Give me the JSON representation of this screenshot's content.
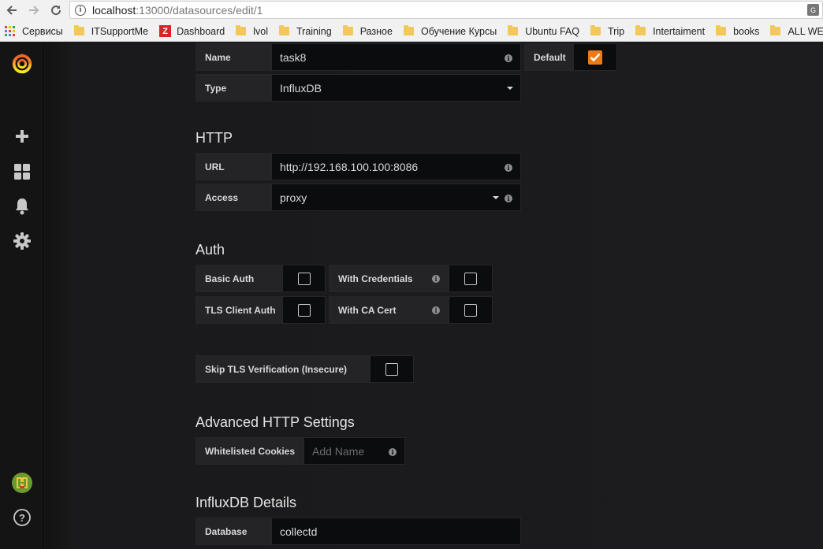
{
  "browser": {
    "url_host": "localhost",
    "url_path": ":13000/datasources/edit/1",
    "bookmarks": [
      {
        "label": "Сервисы",
        "icon": "apps-icon"
      },
      {
        "label": "ITSupportMe",
        "icon": "folder-icon"
      },
      {
        "label": "Dashboard",
        "icon": "z-icon"
      },
      {
        "label": "lvol",
        "icon": "folder-icon"
      },
      {
        "label": "Training",
        "icon": "folder-icon"
      },
      {
        "label": "Разное",
        "icon": "folder-icon"
      },
      {
        "label": "Обучение Курсы",
        "icon": "folder-icon"
      },
      {
        "label": "Ubuntu FAQ",
        "icon": "folder-icon"
      },
      {
        "label": "Trip",
        "icon": "folder-icon"
      },
      {
        "label": "Intertaiment",
        "icon": "folder-icon"
      },
      {
        "label": "books",
        "icon": "folder-icon"
      },
      {
        "label": "ALL WEB",
        "icon": "folder-icon"
      }
    ]
  },
  "sidebar": {
    "icons": [
      "grafana-logo-icon",
      "plus-icon",
      "dashboards-icon",
      "bell-icon",
      "gear-icon",
      "avatar-icon",
      "help-icon"
    ],
    "help_label": "?"
  },
  "form": {
    "name_label": "Name",
    "name_value": "task8",
    "default_label": "Default",
    "default_checked": true,
    "type_label": "Type",
    "type_value": "InfluxDB",
    "http_title": "HTTP",
    "url_label": "URL",
    "url_value": "http://192.168.100.100:8086",
    "access_label": "Access",
    "access_value": "proxy",
    "auth_title": "Auth",
    "basic_auth_label": "Basic Auth",
    "with_credentials_label": "With Credentials",
    "tls_client_auth_label": "TLS Client Auth",
    "with_ca_cert_label": "With CA Cert",
    "skip_tls_label": "Skip TLS Verification (Insecure)",
    "advanced_title": "Advanced HTTP Settings",
    "whitelisted_cookies_label": "Whitelisted Cookies",
    "whitelisted_cookies_placeholder": "Add Name",
    "influx_title": "InfluxDB Details",
    "database_label": "Database",
    "database_value": "collectd"
  },
  "colors": {
    "accent": "#eb7b18",
    "panel_bg": "#1c1c1e",
    "input_bg": "#0b0c0e",
    "label_bg": "#242426"
  }
}
